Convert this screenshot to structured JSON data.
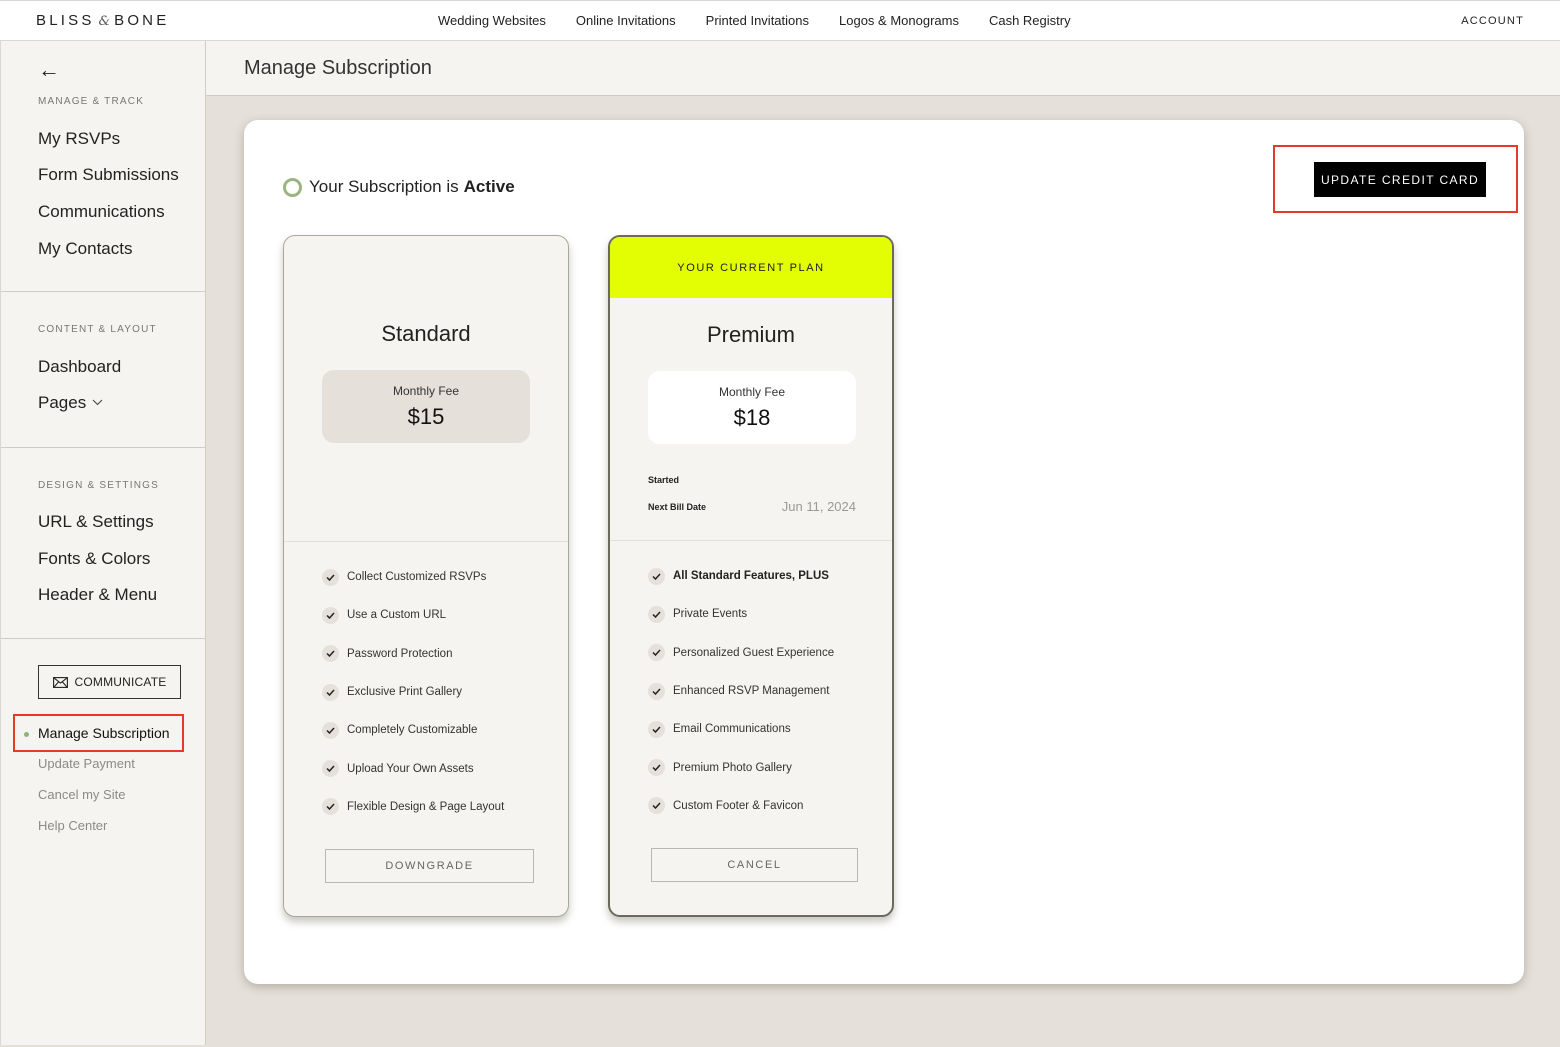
{
  "topnav": {
    "logo_left": "BLISS",
    "logo_amp": "&",
    "logo_right": "BONE",
    "links": [
      "Wedding Websites",
      "Online Invitations",
      "Printed Invitations",
      "Logos & Monograms",
      "Cash Registry"
    ],
    "account": "ACCOUNT"
  },
  "sidebar": {
    "back_icon": "arrow-left-icon",
    "sections": [
      {
        "label": "MANAGE & TRACK",
        "items": [
          "My RSVPs",
          "Form Submissions",
          "Communications",
          "My Contacts"
        ]
      },
      {
        "label": "CONTENT & LAYOUT",
        "items": [
          "Dashboard",
          "Pages"
        ]
      },
      {
        "label": "DESIGN & SETTINGS",
        "items": [
          "URL & Settings",
          "Fonts & Colors",
          "Header & Menu"
        ]
      }
    ],
    "communicate_label": "COMMUNICATE",
    "communicate_icon": "envelope-icon",
    "active_item": "Manage Subscription",
    "active_dot_color": "#8fb27a",
    "sub_items": [
      "Update Payment",
      "Cancel my Site",
      "Help Center"
    ]
  },
  "header": {
    "title": "Manage Subscription"
  },
  "main": {
    "status_prefix": "Your Subscription is",
    "status_value": "Active",
    "status_color": "#9bb482",
    "update_card_label": "UPDATE CREDIT CARD",
    "highlight_color": "#e53a27",
    "plans": [
      {
        "name": "Standard",
        "fee_label": "Monthly Fee",
        "fee": "$15",
        "features": [
          "Collect Customized RSVPs",
          "Use a Custom URL",
          "Password Protection",
          "Exclusive Print Gallery",
          "Completely Customizable",
          "Upload Your Own Assets",
          "Flexible Design & Page Layout"
        ],
        "action": "DOWNGRADE"
      },
      {
        "banner": "YOUR CURRENT PLAN",
        "banner_color": "#e3fd03",
        "name": "Premium",
        "fee_label": "Monthly Fee",
        "fee": "$18",
        "started_label": "Started",
        "started_value": "",
        "next_bill_label": "Next Bill Date",
        "next_bill_value": "Jun 11, 2024",
        "features": [
          "All Standard Features, PLUS",
          "Private Events",
          "Personalized Guest Experience",
          "Enhanced RSVP Management",
          "Email Communications",
          "Premium Photo Gallery",
          "Custom Footer & Favicon"
        ],
        "action": "CANCEL"
      }
    ]
  }
}
